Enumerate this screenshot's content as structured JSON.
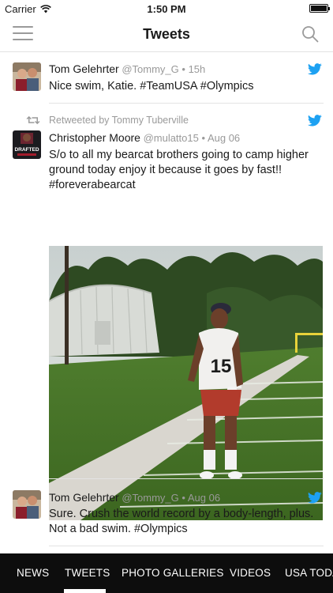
{
  "status_bar": {
    "carrier": "Carrier",
    "time": "1:50 PM"
  },
  "nav": {
    "title": "Tweets"
  },
  "tweets": [
    {
      "author": "Tom Gelehrter",
      "handle": "@Tommy_G",
      "time": "15h",
      "text": "Nice swim, Katie. #TeamUSA #Olympics"
    },
    {
      "retweeted_by": "Retweeted by Tommy Tuberville",
      "author": "Christopher Moore",
      "handle": "@mulatto15",
      "time": "Aug 06",
      "text": "S/o to all my bearcat brothers going to camp higher ground today enjoy it because it goes by fast!! #foreverabearcat",
      "avatar_text": "DRAFTED",
      "jersey_number": "15"
    },
    {
      "author": "Tom Gelehrter",
      "handle": "@Tommy_G",
      "time": "Aug 06",
      "text": "Sure. Crush the world record by a body-length, plus. Not a bad swim. #Olympics"
    }
  ],
  "tabs": [
    "NEWS",
    "TWEETS",
    "PHOTO GALLERIES",
    "VIDEOS",
    "USA TODAY"
  ],
  "active_tab": "TWEETS",
  "colors": {
    "twitter_blue": "#1da1f2",
    "tab_bar": "#0d0d0d"
  }
}
